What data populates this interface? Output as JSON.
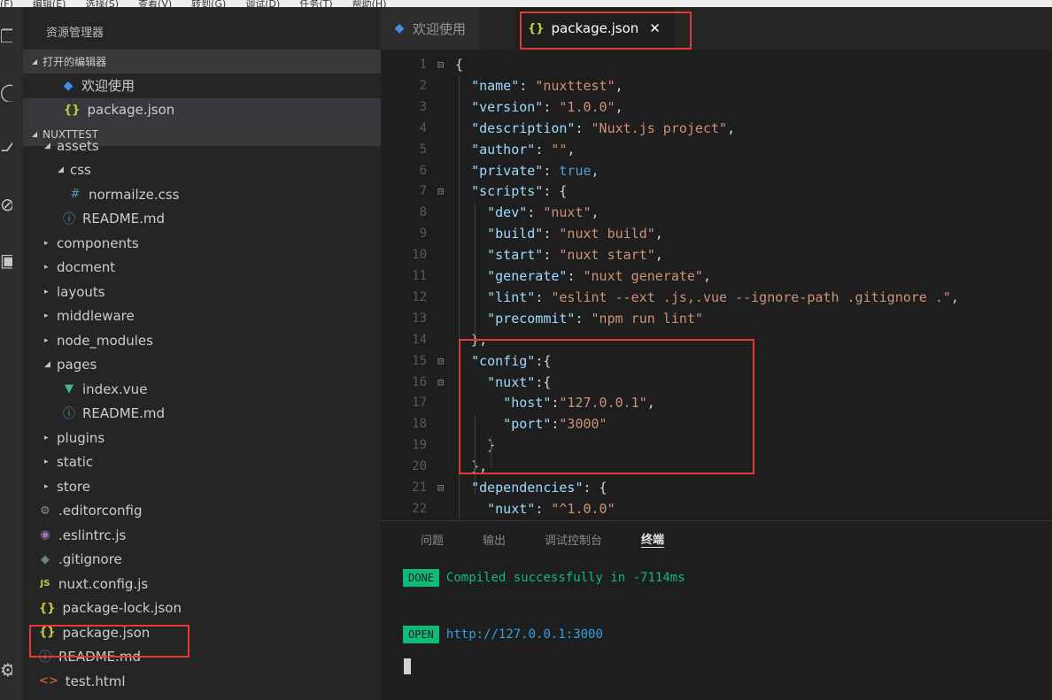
{
  "menubar": [
    "(F)",
    "编辑(E)",
    "选择(S)",
    "查看(V)",
    "转到(G)",
    "调试(D)",
    "任务(T)",
    "帮助(H)"
  ],
  "sidebar": {
    "title": "资源管理器",
    "open_editors_label": "打开的编辑器",
    "open_editors": [
      {
        "label": "欢迎使用",
        "icon": "vscode-icon"
      },
      {
        "label": "package.json",
        "icon": "json-icon"
      }
    ],
    "project_label": "NUXTTEST",
    "tree": [
      {
        "label": "assets",
        "icon": "folder-open",
        "depth": 1
      },
      {
        "label": "css",
        "icon": "folder-open",
        "depth": 2
      },
      {
        "label": "normailze.css",
        "icon": "css-icon",
        "depth": 3
      },
      {
        "label": "README.md",
        "icon": "info-icon",
        "depth": 2
      },
      {
        "label": "components",
        "icon": "folder-closed",
        "depth": 1
      },
      {
        "label": "docment",
        "icon": "folder-closed",
        "depth": 1
      },
      {
        "label": "layouts",
        "icon": "folder-closed",
        "depth": 1
      },
      {
        "label": "middleware",
        "icon": "folder-closed",
        "depth": 1
      },
      {
        "label": "node_modules",
        "icon": "folder-closed",
        "depth": 1
      },
      {
        "label": "pages",
        "icon": "folder-open",
        "depth": 1
      },
      {
        "label": "index.vue",
        "icon": "vue-icon",
        "depth": 2
      },
      {
        "label": "README.md",
        "icon": "info-icon",
        "depth": 2
      },
      {
        "label": "plugins",
        "icon": "folder-closed",
        "depth": 1
      },
      {
        "label": "static",
        "icon": "folder-closed",
        "depth": 1
      },
      {
        "label": "store",
        "icon": "folder-closed",
        "depth": 1
      },
      {
        "label": ".editorconfig",
        "icon": "gear-icon",
        "depth": 1
      },
      {
        "label": ".eslintrc.js",
        "icon": "eslint-icon",
        "depth": 1
      },
      {
        "label": ".gitignore",
        "icon": "git-icon",
        "depth": 1
      },
      {
        "label": "nuxt.config.js",
        "icon": "js-icon",
        "depth": 1
      },
      {
        "label": "package-lock.json",
        "icon": "json-icon",
        "depth": 1
      },
      {
        "label": "package.json",
        "icon": "json-icon",
        "depth": 1
      },
      {
        "label": "README.md",
        "icon": "info-icon",
        "depth": 1
      },
      {
        "label": "test.html",
        "icon": "html-icon",
        "depth": 1
      }
    ]
  },
  "tabs": [
    {
      "label": "欢迎使用",
      "icon": "vscode-icon",
      "active": false
    },
    {
      "label": "package.json",
      "icon": "json-icon",
      "active": true,
      "close": "✕"
    }
  ],
  "code": {
    "line_numbers": [
      "1",
      "2",
      "3",
      "4",
      "5",
      "6",
      "7",
      "8",
      "9",
      "10",
      "11",
      "12",
      "13",
      "14",
      "15",
      "16",
      "17",
      "18",
      "19",
      "20",
      "21",
      "22"
    ],
    "lines": [
      "{",
      "  \"name\": \"nuxttest\",",
      "  \"version\": \"1.0.0\",",
      "  \"description\": \"Nuxt.js project\",",
      "  \"author\": \"\",",
      "  \"private\": true,",
      "  \"scripts\": {",
      "    \"dev\": \"nuxt\",",
      "    \"build\": \"nuxt build\",",
      "    \"start\": \"nuxt start\",",
      "    \"generate\": \"nuxt generate\",",
      "    \"lint\": \"eslint --ext .js,.vue --ignore-path .gitignore .\",",
      "    \"precommit\": \"npm run lint\"",
      "  },",
      "  \"config\":{",
      "    \"nuxt\":{",
      "      \"host\":\"127.0.0.1\",",
      "      \"port\":\"3000\"",
      "    }",
      "  },",
      "  \"dependencies\": {",
      "    \"nuxt\": \"^1.0.0\""
    ],
    "fold_lines": [
      1,
      7,
      15,
      16,
      21
    ]
  },
  "panel": {
    "tabs": [
      {
        "label": "问题",
        "active": false
      },
      {
        "label": "输出",
        "active": false
      },
      {
        "label": "调试控制台",
        "active": false
      },
      {
        "label": "终端",
        "active": true
      }
    ],
    "terminal": [
      {
        "badge": "DONE",
        "text": "Compiled successfully in -7114ms"
      },
      {
        "badge": "OPEN",
        "text": "http://127.0.0.1:3000"
      }
    ]
  },
  "colors": {
    "highlight": "#e53935",
    "json_key": "#9cdcfe",
    "json_string": "#ce9178",
    "json_bool": "#569cd6",
    "terminal_green": "#0dbc79"
  }
}
